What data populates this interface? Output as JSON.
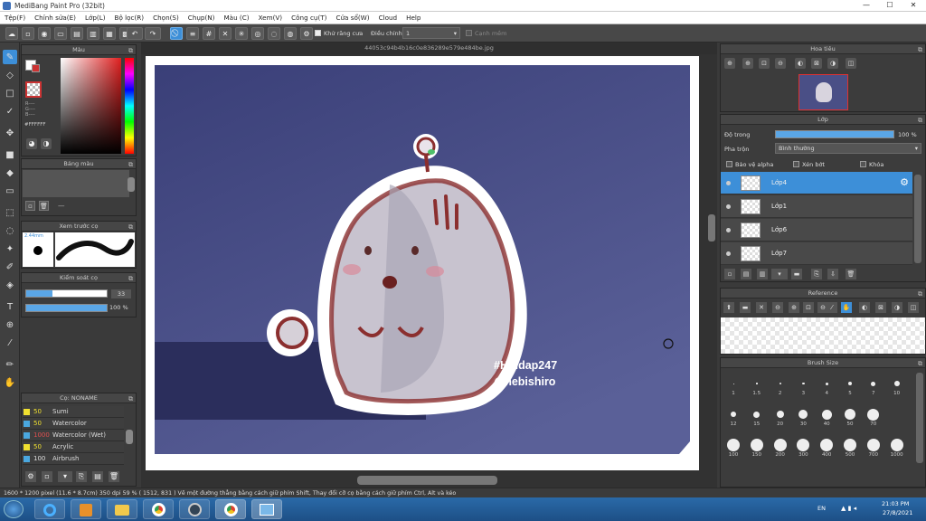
{
  "window": {
    "title": "MediBang Paint Pro (32bit)",
    "min": "—",
    "max": "☐",
    "close": "✕"
  },
  "menu": [
    "Tệp(F)",
    "Chỉnh sửa(E)",
    "Lớp(L)",
    "Bộ lọc(R)",
    "Chọn(S)",
    "Chụp(N)",
    "Màu (C)",
    "Xem(V)",
    "Công cụ(T)",
    "Cửa sổ(W)",
    "Cloud",
    "Help"
  ],
  "toolbar": {
    "antialias_label": "Khử răng cưa",
    "adjust_label": "Điều chỉnh",
    "adjust_value": "1",
    "smooth_label": "Cạnh mềm"
  },
  "document": {
    "filename": "44053c94b4b16c0e836289e579e484be.jpg",
    "watermark_line1": "#Hoidap247",
    "watermark_line2": "@hebishiro"
  },
  "color_panel": {
    "title": "Màu",
    "hex": "#FFFFFF",
    "r": "R----",
    "g": "G----",
    "b": "B----"
  },
  "palette_panel": {
    "title": "Bảng màu",
    "dash": "—"
  },
  "preview_panel": {
    "title": "Xem trước cọ",
    "size": "2.44mm"
  },
  "brush_control": {
    "title": "Kiểm soát cọ",
    "size_value": "33",
    "opacity_value": "100 %"
  },
  "brush_list": {
    "title": "Cọ: NONAME",
    "items": [
      {
        "num": "50",
        "name": "Sumi",
        "color": "#f0e030",
        "numcolor": "#f0e030"
      },
      {
        "num": "50",
        "name": "Watercolor",
        "color": "#4aa8e0",
        "numcolor": "#f0e030"
      },
      {
        "num": "1000",
        "name": "Watercolor (Wet)",
        "color": "#4aa8e0",
        "numcolor": "#e05050"
      },
      {
        "num": "50",
        "name": "Acrylic",
        "color": "#f0e030",
        "numcolor": "#f0e030"
      },
      {
        "num": "100",
        "name": "Airbrush",
        "color": "#4aa8e0",
        "numcolor": "#dddddd"
      }
    ]
  },
  "navigator": {
    "title": "Hoa tiêu"
  },
  "layer_panel": {
    "title": "Lớp",
    "opacity_label": "Độ trong",
    "opacity_value": "100 %",
    "blend_label": "Pha trộn",
    "blend_value": "Bình thường",
    "protect_alpha": "Bảo vệ alpha",
    "clip": "Xén bớt",
    "lock": "Khóa",
    "layers": [
      {
        "name": "Lớp4",
        "selected": true
      },
      {
        "name": "Lớp1",
        "selected": false
      },
      {
        "name": "Lớp6",
        "selected": false
      },
      {
        "name": "Lớp7",
        "selected": false
      }
    ]
  },
  "reference_panel": {
    "title": "Reference"
  },
  "brush_size_panel": {
    "title": "Brush Size",
    "sizes": [
      "1",
      "1.5",
      "2",
      "3",
      "4",
      "5",
      "7",
      "10",
      "12",
      "15",
      "20",
      "30",
      "40",
      "50",
      "70",
      "100",
      "150",
      "200",
      "300",
      "400",
      "500",
      "700",
      "1000"
    ]
  },
  "status": {
    "text": "1600 * 1200 pixel   (11.6 * 8.7cm)   350 dpi   59 %   ( 1512, 831 )   Vẽ một đường thẳng bằng cách giữ phím Shift, Thay đổi cỡ cọ bằng cách giữ phím Ctrl, Alt và kéo"
  },
  "taskbar": {
    "lang": "EN",
    "time": "21:03 PM",
    "date": "27/8/2021"
  },
  "colors": {
    "accent": "#3d8fd8",
    "canvas_bg": "#3b3f7a"
  }
}
